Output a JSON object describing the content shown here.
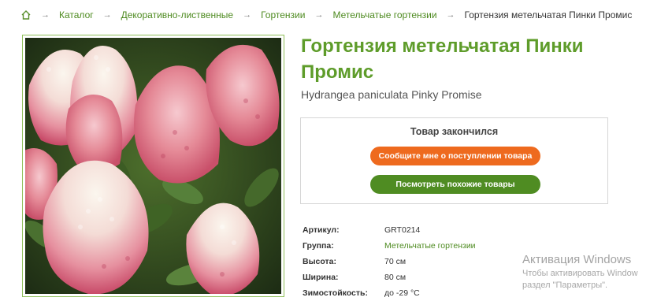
{
  "breadcrumb": {
    "home_icon": "home-icon",
    "separator": "→",
    "items": [
      "Каталог",
      "Декоративно-лиственные",
      "Гортензии",
      "Метельчатые гортензии"
    ],
    "current": "Гортензия метельчатая Пинки Промис"
  },
  "product": {
    "title": "Гортензия метельчатая Пинки Промис",
    "latin_name": "Hydrangea paniculata Pinky Promise",
    "image_subject": "pink-and-white-hydrangea-flowers"
  },
  "stock": {
    "status": "Товар закончился",
    "notify_button": "Сообщите мне о поступлении товара",
    "similar_button": "Посмотреть похожие товары"
  },
  "specs": [
    {
      "label": "Артикул:",
      "value": "GRT0214"
    },
    {
      "label": "Группа:",
      "value": "Метельчатые гортензии"
    },
    {
      "label": "Высота:",
      "value": "70 см"
    },
    {
      "label": "Ширина:",
      "value": "80 см"
    },
    {
      "label": "Зимостойкость:",
      "value": "до -29 °С"
    }
  ],
  "watermark": {
    "title": "Активация Windows",
    "line1": "Чтобы активировать Window",
    "line2": "раздел \"Параметры\"."
  },
  "colors": {
    "accent_green": "#5e9c2a",
    "link_green": "#4d8a1f",
    "notify_orange": "#ee6a1e",
    "similar_green": "#4f8c22"
  }
}
